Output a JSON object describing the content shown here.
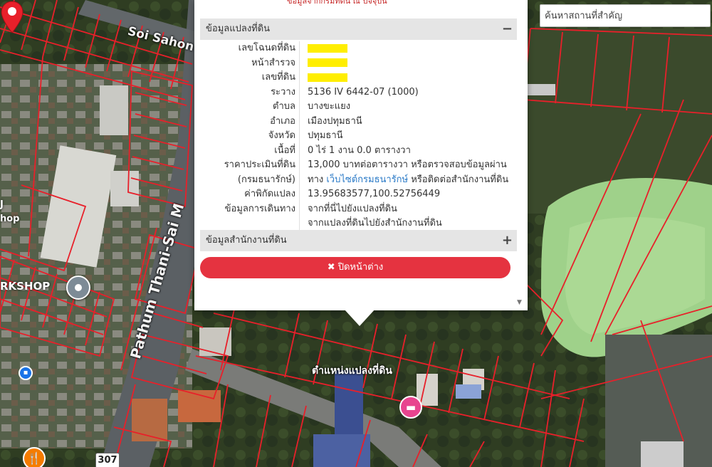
{
  "map": {
    "road_soi": "Soi Sahon",
    "road_main": "Pathum Thani-Sai M",
    "poi_workshop": "RKSHOP",
    "poi_shop": "hop",
    "poi_num": "J",
    "route_number": "307",
    "parcel_marker_label": "ตำแหน่งแปลงที่ดิน",
    "icons": {
      "place": "place-pin-icon",
      "bus": "bus-stop-icon",
      "food": "restaurant-icon",
      "hotel": "hotel-icon",
      "parcel": "parcel-location-pin-icon"
    },
    "parcel_line_color": "#e8202a"
  },
  "search": {
    "placeholder": "ค้นหาสถานที่สำคัญ"
  },
  "popup": {
    "top_text": "ข้อมูลจากกรมที่ดิน ณ ปัจจุบัน",
    "section1": {
      "title": "ข้อมูลแปลงที่ดิน",
      "toggle": "−"
    },
    "rows": [
      {
        "label": "เลขโฉนดที่ดิน",
        "value": ""
      },
      {
        "label": "หน้าสำรวจ",
        "value": ""
      },
      {
        "label": "เลขที่ดิน",
        "value": ""
      },
      {
        "label": "ระวาง",
        "value": "5136 IV 6442-07 (1000)"
      },
      {
        "label": "ตำบล",
        "value": "บางขะแยง"
      },
      {
        "label": "อำเภอ",
        "value": "เมืองปทุมธานี"
      },
      {
        "label": "จังหวัด",
        "value": "ปทุมธานี"
      },
      {
        "label": "เนื้อที่",
        "value": "0 ไร่ 1 งาน 0.0 ตารางวา"
      },
      {
        "label": "ราคาประเมินที่ดิน",
        "value": "13,000 บาทต่อตารางวา หรือตรวจสอบข้อมูลผ่าน"
      },
      {
        "label": "(กรมธนารักษ์)",
        "value_prefix": "ทาง ",
        "value_link": "เว็บไซต์กรมธนารักษ์",
        "value_suffix": " หรือติดต่อสำนักงานที่ดิน"
      },
      {
        "label": "ค่าพิกัดแปลง",
        "value": "13.95683577,100.52756449"
      },
      {
        "label": "ข้อมูลการเดินทาง",
        "value": "จากที่นี่ไปยังแปลงที่ดิน"
      },
      {
        "label": "",
        "value": "จากแปลงที่ดินไปยังสำนักงานที่ดิน"
      }
    ],
    "section2": {
      "title": "ข้อมูลสำนักงานที่ดิน",
      "toggle": "+"
    },
    "close_label": "✖ ปิดหน้าต่าง",
    "scroll_glyph": "▼",
    "highlight_color": "#ffee00",
    "close_color": "#e53340"
  }
}
